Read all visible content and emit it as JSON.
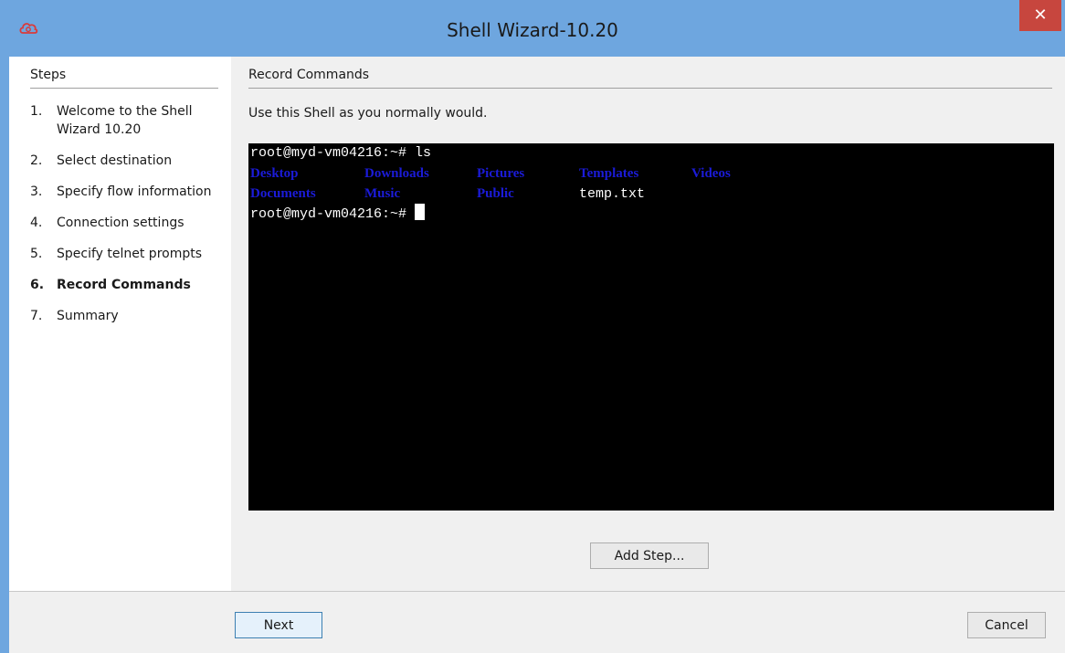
{
  "window": {
    "title": "Shell Wizard-10.20",
    "close_label": "✕",
    "app_icon": "cloud-gear-icon"
  },
  "steps": {
    "header": "Steps",
    "items": [
      {
        "num": "1.",
        "label": "Welcome to the Shell Wizard 10.20",
        "active": false
      },
      {
        "num": "2.",
        "label": "Select destination",
        "active": false
      },
      {
        "num": "3.",
        "label": "Specify flow information",
        "active": false
      },
      {
        "num": "4.",
        "label": "Connection settings",
        "active": false
      },
      {
        "num": "5.",
        "label": "Specify telnet prompts",
        "active": false
      },
      {
        "num": "6.",
        "label": "Record Commands",
        "active": true
      },
      {
        "num": "7.",
        "label": "Summary",
        "active": false
      }
    ]
  },
  "main": {
    "section_title": "Record Commands",
    "instruction": "Use this Shell as you normally would.",
    "add_step_label": "Add Step..."
  },
  "terminal": {
    "prompt_line": "root@myd-vm04216:~# ls",
    "row1": [
      "Desktop",
      "Downloads",
      "Pictures",
      "Templates",
      "Videos"
    ],
    "row2": [
      "Documents",
      "Music",
      "Public",
      "temp.txt"
    ],
    "prompt": "root@myd-vm04216:~# ",
    "dir_color": "#1b1bd8",
    "file_color": "#ffffff"
  },
  "footer": {
    "next_label": "Next",
    "cancel_label": "Cancel"
  },
  "colors": {
    "titlebar": "#6ea6df",
    "close": "#c7463e",
    "terminal_bg": "#000000"
  }
}
